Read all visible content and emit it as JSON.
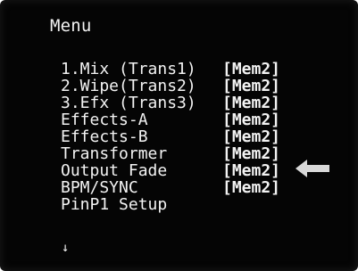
{
  "menu": {
    "title": "Menu",
    "items": [
      {
        "label": "1.Mix (Trans1)",
        "mem": "[Mem2]"
      },
      {
        "label": "2.Wipe(Trans2)",
        "mem": "[Mem2]"
      },
      {
        "label": "3.Efx (Trans3)",
        "mem": "[Mem2]"
      },
      {
        "label": "Effects-A",
        "mem": "[Mem2]"
      },
      {
        "label": "Effects-B",
        "mem": "[Mem2]"
      },
      {
        "label": "Transformer",
        "mem": "[Mem2]"
      },
      {
        "label": "Output Fade",
        "mem": "[Mem2]"
      },
      {
        "label": "BPM/SYNC",
        "mem": "[Mem2]"
      },
      {
        "label": "PinP1 Setup",
        "mem": ""
      }
    ],
    "scroll_indicator": "↓",
    "pointer_icon": "left-arrow-icon",
    "colors": {
      "background": "#050505",
      "text": "#f3f3f3",
      "arrow": "#d9d9d9"
    }
  }
}
